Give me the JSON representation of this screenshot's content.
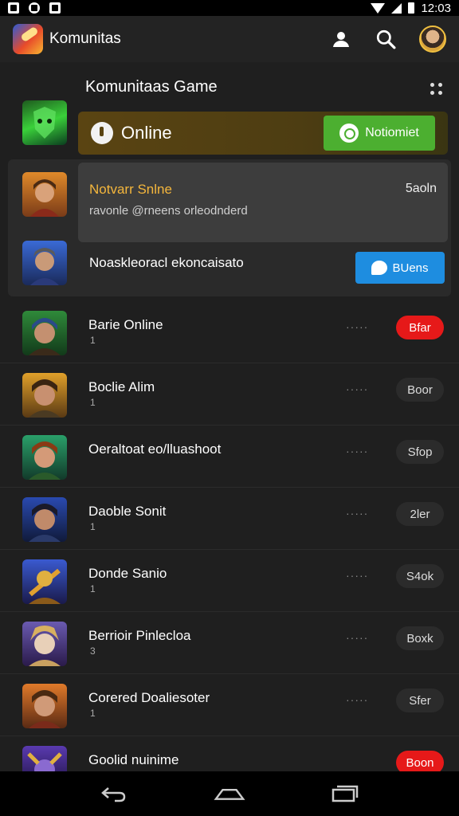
{
  "status_bar": {
    "time": "12:03",
    "icons": [
      "gmail-icon",
      "notification-icon",
      "image-icon",
      "wifi-icon",
      "signal-icon",
      "battery-icon"
    ]
  },
  "app_bar": {
    "title": "Komunitas",
    "actions": [
      "profile-icon",
      "search-icon",
      "avatar"
    ]
  },
  "section": {
    "title": "Komunitaas Game"
  },
  "banner": {
    "label": "Online",
    "button_label": "Notiomiet",
    "accent": "#4caf30"
  },
  "featured": {
    "name": "Notvarr Snlne",
    "status": "5aoln",
    "subtitle": "ravonle @rneens orleodnderd",
    "second_title": "Noaskleoracl ekoncaisato",
    "second_button": "BUens",
    "name_color": "#f4b63c"
  },
  "list": [
    {
      "name": "Barie Online",
      "sub": "1",
      "dots": "·····",
      "action": "Bfar",
      "red": true
    },
    {
      "name": "Boclie Alim",
      "sub": "1",
      "dots": "·····",
      "action": "Boor",
      "red": false
    },
    {
      "name": "Oeraltoat eo/lluashoot",
      "sub": "",
      "dots": "·····",
      "action": "Sfop",
      "red": false
    },
    {
      "name": "Daoble Sonit",
      "sub": "1",
      "dots": "·····",
      "action": "2ler",
      "red": false
    },
    {
      "name": "Donde Sanio",
      "sub": "1",
      "dots": "·····",
      "action": "S4ok",
      "red": false
    },
    {
      "name": "Berrioir Pinlecloa",
      "sub": "3",
      "dots": "·····",
      "action": "Boxk",
      "red": false
    },
    {
      "name": "Corered Doaliesoter",
      "sub": "1",
      "dots": "·····",
      "action": "Sfer",
      "red": false
    },
    {
      "name": "Goolid nuinime",
      "sub": "",
      "dots": "",
      "action": "Boon",
      "red": true
    }
  ],
  "colors": {
    "background": "#1f1f1f",
    "red_pill": "#e61919",
    "blue_button": "#1e8de0"
  }
}
